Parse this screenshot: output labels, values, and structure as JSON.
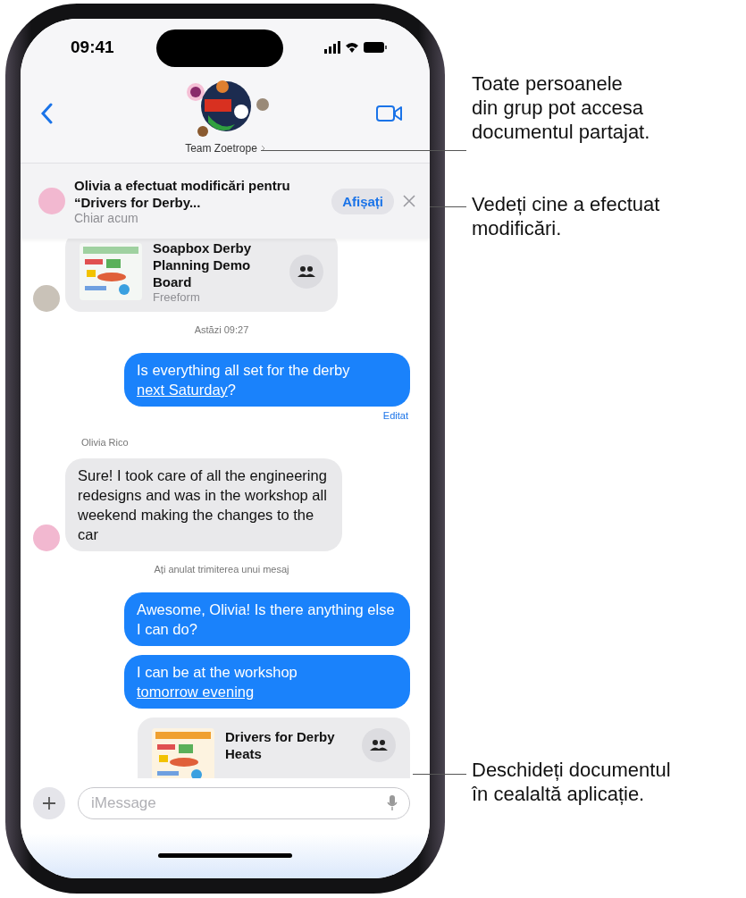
{
  "status_bar": {
    "time": "09:41"
  },
  "header": {
    "group_name": "Team Zoetrope"
  },
  "banner": {
    "message": "Olivia a efectuat modificări pentru “Drivers for Derby...",
    "time": "Chiar acum",
    "action": "Afișați"
  },
  "messages": [
    {
      "kind": "incoming_card",
      "title": "Soapbox Derby Planning Demo Board",
      "app": "Freeform"
    },
    {
      "kind": "timestamp",
      "text": "Astăzi 09:27"
    },
    {
      "kind": "outgoing_bubble",
      "parts": [
        {
          "text": "Is everything all set for the derby ",
          "link": false
        },
        {
          "text": "next Saturday",
          "link": true
        },
        {
          "text": "?",
          "link": false
        }
      ]
    },
    {
      "kind": "note",
      "text": "Editat"
    },
    {
      "kind": "sender",
      "text": "Olivia Rico"
    },
    {
      "kind": "incoming_bubble",
      "parts": [
        {
          "text": "Sure! I took care of all the engineering redesigns and was in the workshop all weekend making the changes to the car",
          "link": false
        }
      ]
    },
    {
      "kind": "timestamp",
      "text": "Ați anulat trimiterea unui mesaj"
    },
    {
      "kind": "outgoing_bubble",
      "parts": [
        {
          "text": "Awesome, Olivia! Is there anything else I can do?",
          "link": false
        }
      ]
    },
    {
      "kind": "outgoing_bubble",
      "parts": [
        {
          "text": "I can be at the workshop ",
          "link": false
        },
        {
          "text": "tomorrow evening",
          "link": true
        }
      ]
    },
    {
      "kind": "outgoing_card",
      "title": "Drivers for Derby Heats"
    }
  ],
  "composer": {
    "placeholder": "iMessage"
  },
  "callouts": [
    {
      "text": "Toate persoanele\ndin grup pot accesa\ndocumentul partajat."
    },
    {
      "text": "Vedeți cine a efectuat\nmodificări."
    },
    {
      "text": "Deschideți documentul\nîn cealaltă aplicație."
    }
  ]
}
